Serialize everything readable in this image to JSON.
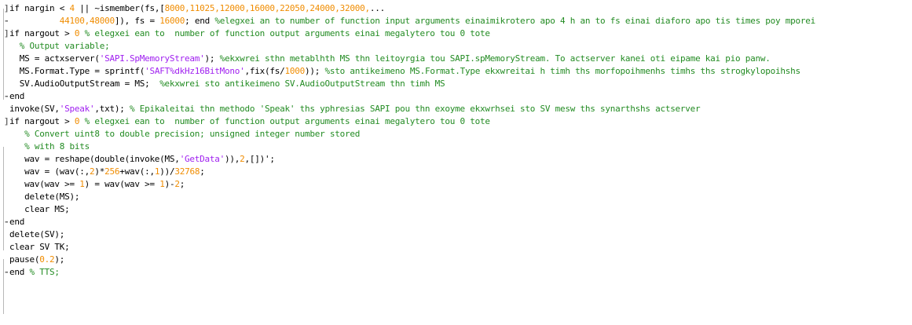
{
  "colors": {
    "background": "#ffffff",
    "code_text": "#000000",
    "string": "#a020f0",
    "number": "#f08c00",
    "comment": "#228b22",
    "fold_marker": "#6b6b6b"
  },
  "icons": [
    "fold-bracket-icon",
    "fold-end-icon",
    "continuation-dash-icon"
  ],
  "lines": [
    {
      "fold": "]",
      "indent": "",
      "tokens": [
        {
          "t": "kw",
          "v": "if nargin < "
        },
        {
          "t": "num",
          "v": "4"
        },
        {
          "t": "kw",
          "v": " || ~ismember(fs,["
        },
        {
          "t": "num",
          "v": "8000,11025,12000,16000,22050,24000,32000,"
        },
        {
          "t": "kw",
          "v": "..."
        }
      ]
    },
    {
      "fold": "-",
      "indent": "          ",
      "tokens": [
        {
          "t": "num",
          "v": "44100,48000"
        },
        {
          "t": "kw",
          "v": "]), fs = "
        },
        {
          "t": "num",
          "v": "16000"
        },
        {
          "t": "kw",
          "v": "; end "
        },
        {
          "t": "cm",
          "v": "%elegxei an to number of function input arguments einaimikrotero apo 4 h an to fs einai diaforo apo tis times poy mporei"
        }
      ]
    },
    {
      "fold": "]",
      "indent": "",
      "tokens": [
        {
          "t": "kw",
          "v": "if nargout > "
        },
        {
          "t": "num",
          "v": "0"
        },
        {
          "t": "kw",
          "v": " "
        },
        {
          "t": "cm",
          "v": "% elegxei ean to  number of function output arguments einai megalytero tou 0 tote"
        }
      ]
    },
    {
      "fold": "",
      "indent": "  ",
      "tokens": [
        {
          "t": "cm",
          "v": "% Output variable;"
        }
      ]
    },
    {
      "fold": "",
      "indent": "  ",
      "tokens": [
        {
          "t": "kw",
          "v": "MS = actxserver("
        },
        {
          "t": "str",
          "v": "'SAPI.SpMemoryStream'"
        },
        {
          "t": "kw",
          "v": "); "
        },
        {
          "t": "cm",
          "v": "%ekxwrei sthn metablhth MS thn leitoyrgia tou SAPI.spMemoryStream. To actserver kanei oti eipame kai pio panw."
        }
      ]
    },
    {
      "fold": "",
      "indent": "  ",
      "tokens": [
        {
          "t": "kw",
          "v": "MS.Format.Type = sprintf("
        },
        {
          "t": "str",
          "v": "'SAFT%dkHz16BitMono'"
        },
        {
          "t": "kw",
          "v": ",fix(fs/"
        },
        {
          "t": "num",
          "v": "1000"
        },
        {
          "t": "kw",
          "v": ")); "
        },
        {
          "t": "cm",
          "v": "%sto antikeimeno MS.Format.Type ekxwreitai h timh ths morfopoihmenhs timhs ths strogkylopoihshs"
        }
      ]
    },
    {
      "fold": "",
      "indent": "  ",
      "tokens": [
        {
          "t": "kw",
          "v": "SV.AudioOutputStream = MS;  "
        },
        {
          "t": "cm",
          "v": "%ekxwrei sto antikeimeno SV.AudioOutputStream thn timh MS"
        }
      ]
    },
    {
      "fold": "-",
      "indent": "",
      "tokens": [
        {
          "t": "kw",
          "v": "end"
        }
      ]
    },
    {
      "fold": "",
      "indent": "",
      "tokens": [
        {
          "t": "kw",
          "v": "invoke(SV,"
        },
        {
          "t": "str",
          "v": "'Speak'"
        },
        {
          "t": "kw",
          "v": ",txt); "
        },
        {
          "t": "cm",
          "v": "% Epikaleitai thn methodo 'Speak' ths yphresias SAPI pou thn exoyme ekxwrhsei sto SV mesw ths synarthshs actserver"
        }
      ]
    },
    {
      "fold": "]",
      "indent": "",
      "tokens": [
        {
          "t": "kw",
          "v": "if nargout > "
        },
        {
          "t": "num",
          "v": "0"
        },
        {
          "t": "kw",
          "v": " "
        },
        {
          "t": "cm",
          "v": "% elegxei ean to  number of function output arguments einai megalytero tou 0 tote"
        }
      ]
    },
    {
      "fold": "",
      "indent": "   ",
      "tokens": [
        {
          "t": "cm",
          "v": "% Convert uint8 to double precision; unsigned integer number stored"
        }
      ]
    },
    {
      "fold": "",
      "indent": "   ",
      "tokens": [
        {
          "t": "cm",
          "v": "% with 8 bits"
        }
      ]
    },
    {
      "fold": "",
      "indent": "   ",
      "tokens": [
        {
          "t": "kw",
          "v": "wav = reshape(double(invoke(MS,"
        },
        {
          "t": "str",
          "v": "'GetData'"
        },
        {
          "t": "kw",
          "v": ")),"
        },
        {
          "t": "num",
          "v": "2"
        },
        {
          "t": "kw",
          "v": ",[])';"
        }
      ]
    },
    {
      "fold": "",
      "indent": "   ",
      "tokens": [
        {
          "t": "kw",
          "v": "wav = (wav(:,"
        },
        {
          "t": "num",
          "v": "2"
        },
        {
          "t": "kw",
          "v": ")*"
        },
        {
          "t": "num",
          "v": "256"
        },
        {
          "t": "kw",
          "v": "+wav(:,"
        },
        {
          "t": "num",
          "v": "1"
        },
        {
          "t": "kw",
          "v": "))/"
        },
        {
          "t": "num",
          "v": "32768"
        },
        {
          "t": "kw",
          "v": ";"
        }
      ]
    },
    {
      "fold": "",
      "indent": "   ",
      "tokens": [
        {
          "t": "kw",
          "v": "wav(wav >= "
        },
        {
          "t": "num",
          "v": "1"
        },
        {
          "t": "kw",
          "v": ") = wav(wav >= "
        },
        {
          "t": "num",
          "v": "1"
        },
        {
          "t": "kw",
          "v": ")-"
        },
        {
          "t": "num",
          "v": "2"
        },
        {
          "t": "kw",
          "v": ";"
        }
      ]
    },
    {
      "fold": "",
      "indent": "   ",
      "tokens": [
        {
          "t": "kw",
          "v": "delete(MS);"
        }
      ]
    },
    {
      "fold": "",
      "indent": "   ",
      "tokens": [
        {
          "t": "kw",
          "v": "clear MS;"
        }
      ]
    },
    {
      "fold": "-",
      "indent": "",
      "tokens": [
        {
          "t": "kw",
          "v": "end"
        }
      ]
    },
    {
      "fold": "",
      "indent": "",
      "tokens": [
        {
          "t": "kw",
          "v": "delete(SV);"
        }
      ]
    },
    {
      "fold": "",
      "indent": "",
      "tokens": [
        {
          "t": "kw",
          "v": "clear SV TK;"
        }
      ]
    },
    {
      "fold": "",
      "indent": "",
      "tokens": [
        {
          "t": "kw",
          "v": "pause("
        },
        {
          "t": "num",
          "v": "0.2"
        },
        {
          "t": "kw",
          "v": ");"
        }
      ]
    },
    {
      "fold": "-",
      "indent": "",
      "tokens": [
        {
          "t": "kw",
          "v": "end "
        },
        {
          "t": "cm",
          "v": "% TTS;"
        }
      ]
    }
  ]
}
